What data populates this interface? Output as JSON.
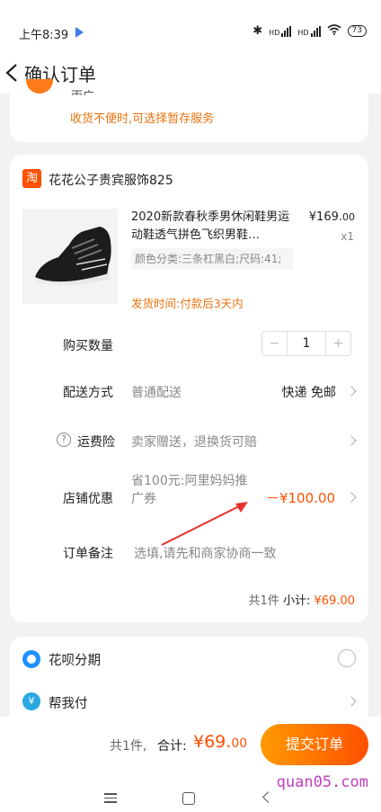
{
  "status_bar": {
    "time": "上午8:39",
    "signal_label_1": "HD",
    "signal_label_2": "HD",
    "battery": "73"
  },
  "nav": {
    "title": "确认订单"
  },
  "address": {
    "partial_text": "両广",
    "tip": "收货不便时,可选择暂存服务"
  },
  "shop": {
    "logo_text": "淘",
    "name": "花花公子贵宾服饰825"
  },
  "product": {
    "title": "2020新款春秋季男休闲鞋男运动鞋透气拼色飞织男鞋…",
    "sku": "颜色分类:三条杠黑白;尺码:41;",
    "ship_time": "发货时间:付款后3天内",
    "price_int": "¥169.",
    "price_dec": "00",
    "qty": "x1"
  },
  "order": {
    "quantity_label": "购买数量",
    "quantity_value": "1",
    "minus": "−",
    "plus": "+",
    "delivery_label": "配送方式",
    "delivery_value": "普通配送",
    "delivery_type": "快递 免邮",
    "insurance_label": "运费险",
    "insurance_value": "卖家赠送，退换货可赔",
    "coupon_label": "店铺优惠",
    "coupon_desc": "省100元:阿里妈妈推广券",
    "coupon_amount": "－¥100.00",
    "note_label": "订单备注",
    "note_placeholder": "选填,请先和商家协商一致",
    "subtotal_count": "共1件",
    "subtotal_label": "小计:",
    "subtotal_amount": "¥69.00"
  },
  "payment": {
    "huabei_label": "花呗分期",
    "bangwofu_label": "帮我付",
    "bangwofu_icon_text": "¥"
  },
  "bottom": {
    "count": "共1件,",
    "total_label": "合计:",
    "total_int": "¥69.",
    "total_dec": "00",
    "submit": "提交订单"
  },
  "watermark": "quan05.com",
  "colors": {
    "accent": "#ff5000",
    "tip_orange": "#e8730f"
  }
}
